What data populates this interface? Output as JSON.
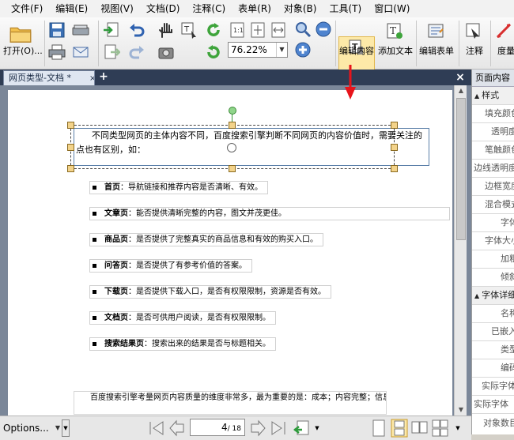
{
  "menu": [
    "文件(F)",
    "编辑(E)",
    "视图(V)",
    "文档(D)",
    "注释(C)",
    "表单(R)",
    "对象(B)",
    "工具(T)",
    "窗口(W)"
  ],
  "toolbar": {
    "open_label": "打开(O)...",
    "zoom_value": "76.22%",
    "edit_content_label": "编辑内容",
    "add_text_label": "添加文本",
    "edit_form_label": "编辑表单",
    "annotate_label": "注释",
    "measure_label": "度量"
  },
  "tab": {
    "title": "网页类型-文档 *",
    "close": "×",
    "plus": "+",
    "close_all": "×"
  },
  "page": {
    "paragraph_line1": "不同类型网页的主体内容不同，百度搜索引擎判断不同网页的内容价值时，需要关注的",
    "paragraph_line2": "点也有区别，如：",
    "bullets": [
      {
        "title": "首页",
        "text": "：导航链接和推荐内容是否清晰、有效。"
      },
      {
        "title": "文章页",
        "text": "：能否提供清晰完整的内容，图文并茂更佳。"
      },
      {
        "title": "商品页",
        "text": "：是否提供了完整真实的商品信息和有效的购买入口。"
      },
      {
        "title": "问答页",
        "text": "：是否提供了有参考价值的答案。"
      },
      {
        "title": "下载页",
        "text": "：是否提供下载入口，是否有权限限制，资源是否有效。"
      },
      {
        "title": "文档页",
        "text": "：是否可供用户阅读，是否有权限限制。"
      },
      {
        "title": "搜索结果页",
        "text": "：搜索出来的结果是否与标题相关。"
      }
    ],
    "bottom_text": "百度搜索引擎考量网页内容质量的维度非常多，最为重要的是：成本；内容完整；信息"
  },
  "status": {
    "options_label": "Options...",
    "page_indicator": "4",
    "page_total": "/ 18"
  },
  "sidepanel": {
    "title": "页面内容",
    "group_style": "样式",
    "rows": [
      "填充颜色",
      "透明度",
      "笔触颜色",
      "边线透明度",
      "边框宽度",
      "混合模式",
      "字体",
      "字体大小",
      "加粗",
      "倾斜"
    ],
    "group_font": "字体详细",
    "rows2": [
      "名称",
      "已嵌入",
      "类型",
      "编码",
      "实际字体",
      "实际字体",
      "对象数目"
    ]
  },
  "colors": {
    "tabbar": "#2f3d55",
    "doc_background": "#7b8799",
    "edit_highlight": "#fde9a8",
    "red_arrow": "#e8141b"
  }
}
